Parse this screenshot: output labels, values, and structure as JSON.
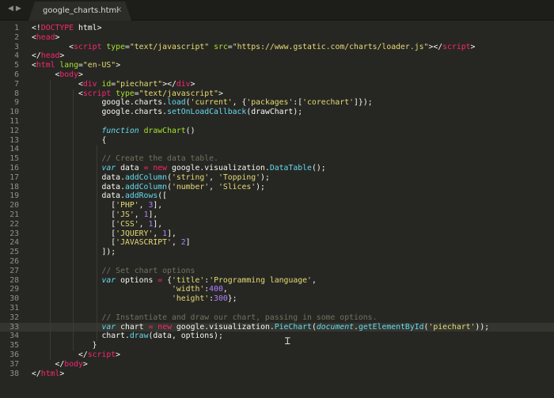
{
  "tabbar": {
    "back_arrow": "◀",
    "forward_arrow": "▶",
    "tab_title": "google_charts.html",
    "tab_close": "×"
  },
  "editor": {
    "active_line": 33,
    "lines": [
      {
        "num": "1",
        "tokens": [
          {
            "t": "<!",
            "c": "plain"
          },
          {
            "t": "DOCTYPE",
            "c": "tag"
          },
          {
            "t": " html>",
            "c": "plain"
          }
        ]
      },
      {
        "num": "2",
        "tokens": [
          {
            "t": "<",
            "c": "plain"
          },
          {
            "t": "head",
            "c": "tag"
          },
          {
            "t": ">",
            "c": "plain"
          }
        ]
      },
      {
        "num": "3",
        "tokens": [
          {
            "t": "        <",
            "c": "plain"
          },
          {
            "t": "script",
            "c": "tag"
          },
          {
            "t": " ",
            "c": "plain"
          },
          {
            "t": "type",
            "c": "attr"
          },
          {
            "t": "=",
            "c": "plain"
          },
          {
            "t": "\"text/javascript\"",
            "c": "str"
          },
          {
            "t": " ",
            "c": "plain"
          },
          {
            "t": "src",
            "c": "attr"
          },
          {
            "t": "=",
            "c": "plain"
          },
          {
            "t": "\"https://www.gstatic.com/charts/loader.js\"",
            "c": "str"
          },
          {
            "t": "></",
            "c": "plain"
          },
          {
            "t": "script",
            "c": "tag"
          },
          {
            "t": ">",
            "c": "plain"
          }
        ]
      },
      {
        "num": "4",
        "tokens": [
          {
            "t": "</",
            "c": "plain"
          },
          {
            "t": "head",
            "c": "tag"
          },
          {
            "t": ">",
            "c": "plain"
          }
        ]
      },
      {
        "num": "5",
        "tokens": [
          {
            "t": "<",
            "c": "plain"
          },
          {
            "t": "html",
            "c": "tag"
          },
          {
            "t": " ",
            "c": "plain"
          },
          {
            "t": "lang",
            "c": "attr"
          },
          {
            "t": "=",
            "c": "plain"
          },
          {
            "t": "\"en-US\"",
            "c": "str"
          },
          {
            "t": ">",
            "c": "plain"
          }
        ]
      },
      {
        "num": "6",
        "tokens": [
          {
            "t": "     <",
            "c": "plain"
          },
          {
            "t": "body",
            "c": "tag"
          },
          {
            "t": ">",
            "c": "plain"
          }
        ]
      },
      {
        "num": "7",
        "tokens": [
          {
            "t": "          <",
            "c": "plain"
          },
          {
            "t": "div",
            "c": "tag"
          },
          {
            "t": " ",
            "c": "plain"
          },
          {
            "t": "id",
            "c": "attr"
          },
          {
            "t": "=",
            "c": "plain"
          },
          {
            "t": "\"piechart\"",
            "c": "str"
          },
          {
            "t": "></",
            "c": "plain"
          },
          {
            "t": "div",
            "c": "tag"
          },
          {
            "t": ">",
            "c": "plain"
          }
        ]
      },
      {
        "num": "8",
        "tokens": [
          {
            "t": "          <",
            "c": "plain"
          },
          {
            "t": "script",
            "c": "tag"
          },
          {
            "t": " ",
            "c": "plain"
          },
          {
            "t": "type",
            "c": "attr"
          },
          {
            "t": "=",
            "c": "plain"
          },
          {
            "t": "\"text/javascript\"",
            "c": "str"
          },
          {
            "t": ">",
            "c": "plain"
          }
        ]
      },
      {
        "num": "9",
        "tokens": [
          {
            "t": "               google.charts.",
            "c": "plain"
          },
          {
            "t": "load",
            "c": "fnc"
          },
          {
            "t": "(",
            "c": "plain"
          },
          {
            "t": "'current'",
            "c": "str"
          },
          {
            "t": ", {",
            "c": "plain"
          },
          {
            "t": "'packages'",
            "c": "str"
          },
          {
            "t": ":[",
            "c": "plain"
          },
          {
            "t": "'corechart'",
            "c": "str"
          },
          {
            "t": "]});",
            "c": "plain"
          }
        ]
      },
      {
        "num": "10",
        "tokens": [
          {
            "t": "               google.charts.",
            "c": "plain"
          },
          {
            "t": "setOnLoadCallback",
            "c": "fnc"
          },
          {
            "t": "(drawChart);",
            "c": "plain"
          }
        ]
      },
      {
        "num": "11",
        "tokens": []
      },
      {
        "num": "12",
        "tokens": [
          {
            "t": "               ",
            "c": "plain"
          },
          {
            "t": "function",
            "c": "kw"
          },
          {
            "t": " ",
            "c": "plain"
          },
          {
            "t": "drawChart",
            "c": "fn"
          },
          {
            "t": "()",
            "c": "plain"
          }
        ]
      },
      {
        "num": "13",
        "tokens": [
          {
            "t": "               {",
            "c": "plain"
          }
        ]
      },
      {
        "num": "14",
        "tokens": []
      },
      {
        "num": "15",
        "tokens": [
          {
            "t": "               ",
            "c": "plain"
          },
          {
            "t": "// Create the data table.",
            "c": "cm"
          }
        ]
      },
      {
        "num": "16",
        "tokens": [
          {
            "t": "               ",
            "c": "plain"
          },
          {
            "t": "var",
            "c": "kw"
          },
          {
            "t": " data ",
            "c": "plain"
          },
          {
            "t": "=",
            "c": "tag"
          },
          {
            "t": " ",
            "c": "plain"
          },
          {
            "t": "new",
            "c": "tag"
          },
          {
            "t": " google.visualization.",
            "c": "plain"
          },
          {
            "t": "DataTable",
            "c": "fnc"
          },
          {
            "t": "();",
            "c": "plain"
          }
        ]
      },
      {
        "num": "17",
        "tokens": [
          {
            "t": "               data.",
            "c": "plain"
          },
          {
            "t": "addColumn",
            "c": "fnc"
          },
          {
            "t": "(",
            "c": "plain"
          },
          {
            "t": "'string'",
            "c": "str"
          },
          {
            "t": ", ",
            "c": "plain"
          },
          {
            "t": "'Topping'",
            "c": "str"
          },
          {
            "t": ");",
            "c": "plain"
          }
        ]
      },
      {
        "num": "18",
        "tokens": [
          {
            "t": "               data.",
            "c": "plain"
          },
          {
            "t": "addColumn",
            "c": "fnc"
          },
          {
            "t": "(",
            "c": "plain"
          },
          {
            "t": "'number'",
            "c": "str"
          },
          {
            "t": ", ",
            "c": "plain"
          },
          {
            "t": "'Slices'",
            "c": "str"
          },
          {
            "t": ");",
            "c": "plain"
          }
        ]
      },
      {
        "num": "19",
        "tokens": [
          {
            "t": "               data.",
            "c": "plain"
          },
          {
            "t": "addRows",
            "c": "fnc"
          },
          {
            "t": "([",
            "c": "plain"
          }
        ]
      },
      {
        "num": "20",
        "tokens": [
          {
            "t": "                 [",
            "c": "plain"
          },
          {
            "t": "'PHP'",
            "c": "str"
          },
          {
            "t": ", ",
            "c": "plain"
          },
          {
            "t": "3",
            "c": "num-lit"
          },
          {
            "t": "],",
            "c": "plain"
          }
        ]
      },
      {
        "num": "21",
        "tokens": [
          {
            "t": "                 [",
            "c": "plain"
          },
          {
            "t": "'JS'",
            "c": "str"
          },
          {
            "t": ", ",
            "c": "plain"
          },
          {
            "t": "1",
            "c": "num-lit"
          },
          {
            "t": "],",
            "c": "plain"
          }
        ]
      },
      {
        "num": "22",
        "tokens": [
          {
            "t": "                 [",
            "c": "plain"
          },
          {
            "t": "'CSS'",
            "c": "str"
          },
          {
            "t": ", ",
            "c": "plain"
          },
          {
            "t": "1",
            "c": "num-lit"
          },
          {
            "t": "],",
            "c": "plain"
          }
        ]
      },
      {
        "num": "23",
        "tokens": [
          {
            "t": "                 [",
            "c": "plain"
          },
          {
            "t": "'JQUERY'",
            "c": "str"
          },
          {
            "t": ", ",
            "c": "plain"
          },
          {
            "t": "1",
            "c": "num-lit"
          },
          {
            "t": "],",
            "c": "plain"
          }
        ]
      },
      {
        "num": "24",
        "tokens": [
          {
            "t": "                 [",
            "c": "plain"
          },
          {
            "t": "'JAVASCRIPT'",
            "c": "str"
          },
          {
            "t": ", ",
            "c": "plain"
          },
          {
            "t": "2",
            "c": "num-lit"
          },
          {
            "t": "]",
            "c": "plain"
          }
        ]
      },
      {
        "num": "25",
        "tokens": [
          {
            "t": "               ]);",
            "c": "plain"
          }
        ]
      },
      {
        "num": "26",
        "tokens": []
      },
      {
        "num": "27",
        "tokens": [
          {
            "t": "               ",
            "c": "plain"
          },
          {
            "t": "// Set chart options",
            "c": "cm"
          }
        ]
      },
      {
        "num": "28",
        "tokens": [
          {
            "t": "               ",
            "c": "plain"
          },
          {
            "t": "var",
            "c": "kw"
          },
          {
            "t": " options ",
            "c": "plain"
          },
          {
            "t": "=",
            "c": "tag"
          },
          {
            "t": " {",
            "c": "plain"
          },
          {
            "t": "'title'",
            "c": "str"
          },
          {
            "t": ":",
            "c": "plain"
          },
          {
            "t": "'Programming language'",
            "c": "str"
          },
          {
            "t": ",",
            "c": "plain"
          }
        ]
      },
      {
        "num": "29",
        "tokens": [
          {
            "t": "                              ",
            "c": "plain"
          },
          {
            "t": "'width'",
            "c": "str"
          },
          {
            "t": ":",
            "c": "plain"
          },
          {
            "t": "400",
            "c": "num-lit"
          },
          {
            "t": ",",
            "c": "plain"
          }
        ]
      },
      {
        "num": "30",
        "tokens": [
          {
            "t": "                              ",
            "c": "plain"
          },
          {
            "t": "'height'",
            "c": "str"
          },
          {
            "t": ":",
            "c": "plain"
          },
          {
            "t": "300",
            "c": "num-lit"
          },
          {
            "t": "};",
            "c": "plain"
          }
        ]
      },
      {
        "num": "31",
        "tokens": []
      },
      {
        "num": "32",
        "tokens": [
          {
            "t": "               ",
            "c": "plain"
          },
          {
            "t": "// Instantiate and draw our chart, passing in some options.",
            "c": "cm"
          }
        ]
      },
      {
        "num": "33",
        "tokens": [
          {
            "t": "               ",
            "c": "plain"
          },
          {
            "t": "var",
            "c": "kw"
          },
          {
            "t": " chart ",
            "c": "plain"
          },
          {
            "t": "=",
            "c": "tag"
          },
          {
            "t": " ",
            "c": "plain"
          },
          {
            "t": "new",
            "c": "tag"
          },
          {
            "t": " google.visualization.",
            "c": "plain"
          },
          {
            "t": "PieChart",
            "c": "fnc"
          },
          {
            "t": "(",
            "c": "plain"
          },
          {
            "t": "document",
            "c": "kw"
          },
          {
            "t": ".",
            "c": "plain"
          },
          {
            "t": "getElementById",
            "c": "fnc"
          },
          {
            "t": "(",
            "c": "plain"
          },
          {
            "t": "'piechart'",
            "c": "str"
          },
          {
            "t": "));",
            "c": "plain"
          }
        ]
      },
      {
        "num": "34",
        "tokens": [
          {
            "t": "               chart.",
            "c": "plain"
          },
          {
            "t": "draw",
            "c": "fnc"
          },
          {
            "t": "(data, options);",
            "c": "plain"
          }
        ]
      },
      {
        "num": "35",
        "tokens": [
          {
            "t": "             }",
            "c": "plain"
          }
        ]
      },
      {
        "num": "36",
        "tokens": [
          {
            "t": "          </",
            "c": "plain"
          },
          {
            "t": "script",
            "c": "tag"
          },
          {
            "t": ">",
            "c": "plain"
          }
        ]
      },
      {
        "num": "37",
        "tokens": [
          {
            "t": "     </",
            "c": "plain"
          },
          {
            "t": "body",
            "c": "tag"
          },
          {
            "t": ">",
            "c": "plain"
          }
        ]
      },
      {
        "num": "38",
        "tokens": [
          {
            "t": "</",
            "c": "plain"
          },
          {
            "t": "html",
            "c": "tag"
          },
          {
            "t": ">",
            "c": "plain"
          }
        ]
      }
    ]
  },
  "colors": {
    "background": "#262723",
    "tag": "#f92672",
    "attribute": "#a6e22e",
    "string": "#e6db74",
    "keyword": "#66d9ef",
    "comment": "#75715e",
    "number": "#ae81ff",
    "text": "#f8f8f2"
  },
  "mouse_cursor": "ibeam-cursor-icon"
}
